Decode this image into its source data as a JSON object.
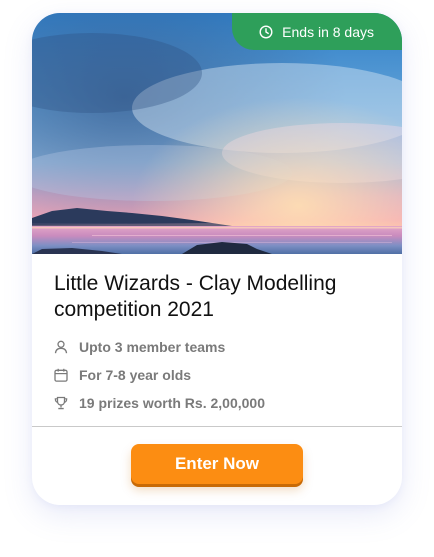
{
  "badge": {
    "text": "Ends in 8 days",
    "icon": "clock-icon"
  },
  "hero_image": {
    "description_icon": "sunset-seascape-photo"
  },
  "title": "Little Wizards - Clay Modelling competition 2021",
  "meta": [
    {
      "icon": "user-icon",
      "text": "Upto 3 member teams"
    },
    {
      "icon": "calendar-icon",
      "text": "For 7-8 year olds"
    },
    {
      "icon": "trophy-icon",
      "text": "19 prizes worth Rs. 2,00,000"
    }
  ],
  "cta": {
    "label": "Enter Now"
  },
  "colors": {
    "badge_bg": "#2e9f5a",
    "cta_bg": "#fc8d12",
    "title": "#111111",
    "meta_text": "#7a7a7a"
  }
}
